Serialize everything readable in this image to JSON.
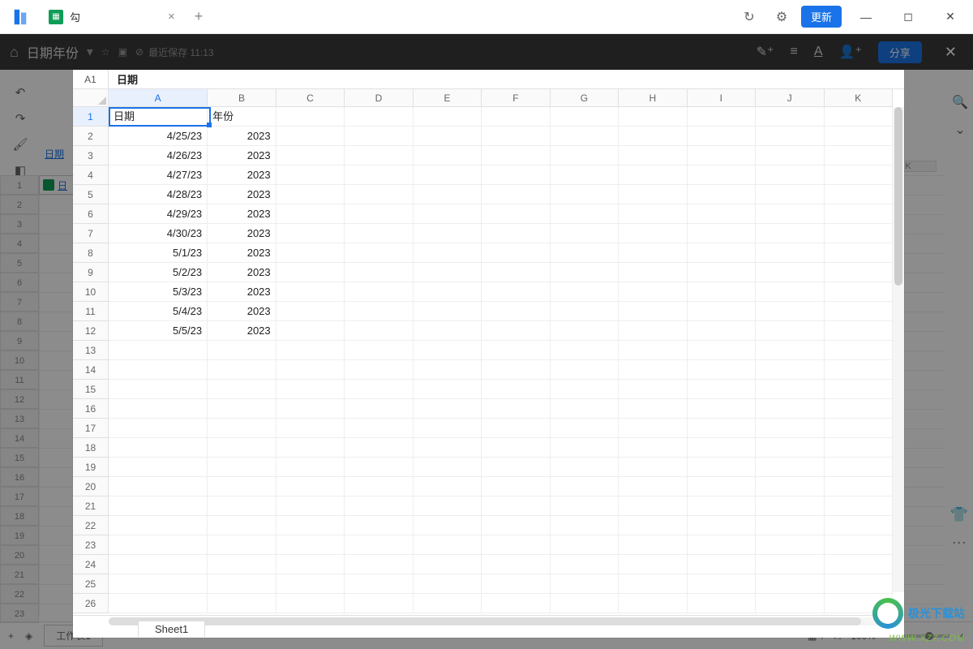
{
  "titlebar": {
    "tab_label": "勾",
    "update_btn": "更新"
  },
  "docheader": {
    "title": "日期年份",
    "last_save": "最近保存 11:13",
    "share": "分享"
  },
  "background": {
    "a1_label": "A1",
    "link_text": "日期",
    "cell_link": "日",
    "sheet_tab": "工作表1",
    "zoom": "100%",
    "col_header": "K"
  },
  "modal": {
    "namebox": "A1",
    "formula_value": "日期",
    "columns": [
      "A",
      "B",
      "C",
      "D",
      "E",
      "F",
      "G",
      "H",
      "I",
      "J",
      "K"
    ],
    "row_count": 26,
    "sheet_name": "Sheet1",
    "headers": {
      "A": "日期",
      "B": "年份"
    },
    "data": [
      {
        "A": "4/25/23",
        "B": "2023"
      },
      {
        "A": "4/26/23",
        "B": "2023"
      },
      {
        "A": "4/27/23",
        "B": "2023"
      },
      {
        "A": "4/28/23",
        "B": "2023"
      },
      {
        "A": "4/29/23",
        "B": "2023"
      },
      {
        "A": "4/30/23",
        "B": "2023"
      },
      {
        "A": "5/1/23",
        "B": "2023"
      },
      {
        "A": "5/2/23",
        "B": "2023"
      },
      {
        "A": "5/3/23",
        "B": "2023"
      },
      {
        "A": "5/4/23",
        "B": "2023"
      },
      {
        "A": "5/5/23",
        "B": "2023"
      }
    ]
  },
  "watermark": {
    "text": "极光下载站",
    "url": "WWW.XZ7.COM"
  }
}
